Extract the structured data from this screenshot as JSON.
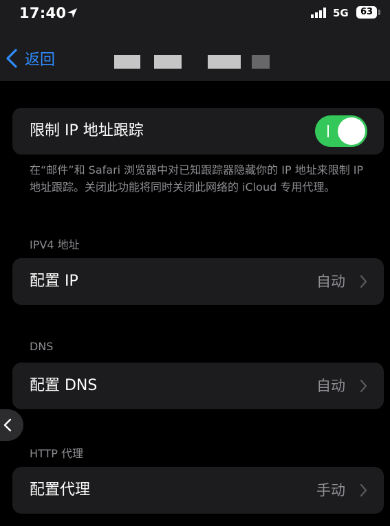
{
  "status_bar": {
    "time": "17:40",
    "network": "5G",
    "battery": "63"
  },
  "nav": {
    "back_label": "返回"
  },
  "tracking": {
    "label": "限制 IP 地址跟踪",
    "enabled": true,
    "footnote": "在“邮件”和 Safari 浏览器中对已知跟踪器隐藏你的 IP 地址来限制 IP 地址跟踪。关闭此功能将同时关闭此网络的 iCloud 专用代理。"
  },
  "ipv4": {
    "header": "IPV4 地址",
    "config_label": "配置 IP",
    "config_value": "自动"
  },
  "dns": {
    "header": "DNS",
    "config_label": "配置 DNS",
    "config_value": "自动"
  },
  "proxy": {
    "header": "HTTP 代理",
    "config_label": "配置代理",
    "config_value": "手动"
  },
  "colors": {
    "accent": "#2f8cff",
    "toggle_on": "#34c759",
    "card": "#1c1c1e",
    "secondary_text": "#8e8e93"
  }
}
